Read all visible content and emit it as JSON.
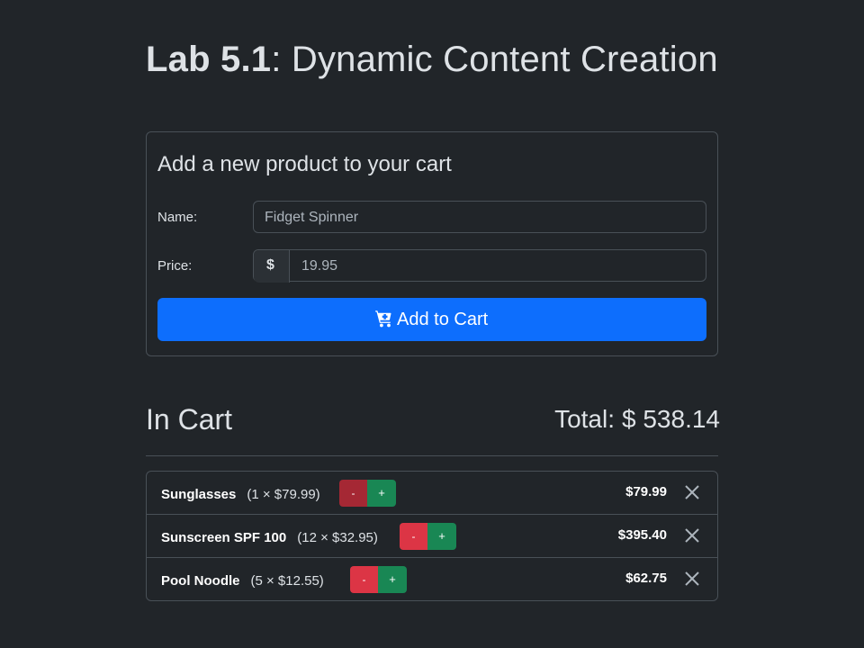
{
  "page": {
    "title_bold": "Lab 5.1",
    "title_rest": ": Dynamic Content Creation"
  },
  "form": {
    "heading": "Add a new product to your cart",
    "name_label": "Name:",
    "name_value": "Fidget Spinner",
    "price_label": "Price:",
    "price_prefix": "$",
    "price_value": "19.95",
    "add_button_label": "Add to Cart",
    "add_button_icon": "cart-plus-icon"
  },
  "cart": {
    "title": "In Cart",
    "total_label": "Total:",
    "total_value": "$ 538.14",
    "items": [
      {
        "name": "Sunglasses",
        "qty_text": "(1 × $79.99)",
        "minus_label": "-",
        "plus_label": "+",
        "line_total": "$79.99"
      },
      {
        "name": "Sunscreen SPF 100",
        "qty_text": "(12 × $32.95)",
        "minus_label": "-",
        "plus_label": "+",
        "line_total": "$395.40"
      },
      {
        "name": "Pool Noodle",
        "qty_text": "(5 × $12.55)",
        "minus_label": "-",
        "plus_label": "+",
        "line_total": "$62.75"
      }
    ]
  },
  "colors": {
    "background": "#212529",
    "primary": "#0d6efd",
    "danger": "#dc3545",
    "success": "#198754"
  }
}
